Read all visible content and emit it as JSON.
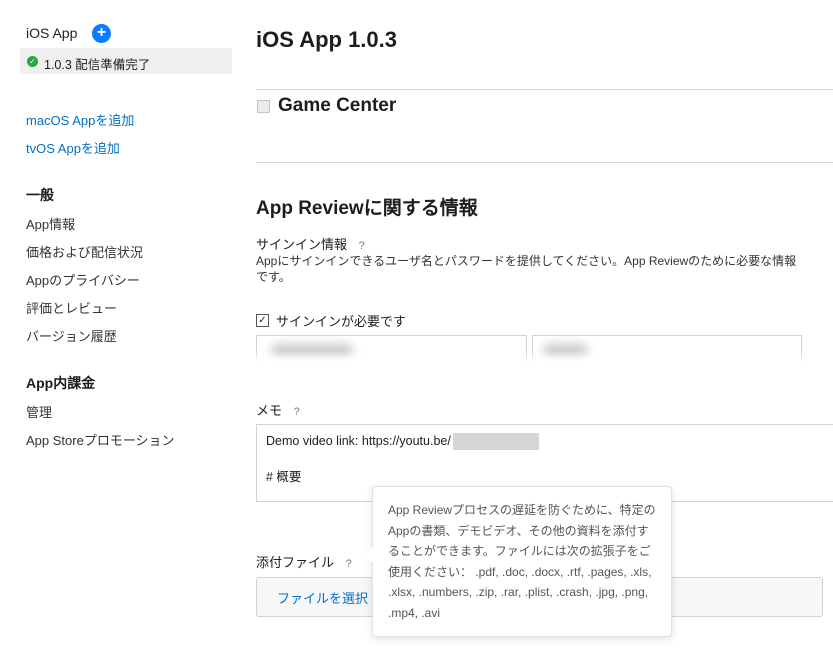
{
  "sidebar": {
    "app_title": "iOS App",
    "add_symbol": "+",
    "status_text": "1.0.3 配信準備完了",
    "status_color": "#28a745",
    "links": [
      "macOS Appを追加",
      "tvOS Appを追加"
    ],
    "general_heading": "一般",
    "general_items": [
      "App情報",
      "価格および配信状況",
      "Appのプライバシー",
      "評価とレビュー",
      "バージョン履歴"
    ],
    "iap_heading": "App内課金",
    "iap_items": [
      "管理",
      "App Storeプロモーション"
    ]
  },
  "main": {
    "title": "iOS App 1.0.3",
    "game_center_label": "Game Center",
    "review_section_title": "App Reviewに関する情報",
    "signin_info_label": "サインイン情報",
    "help_symbol": "?",
    "signin_description": "Appにサインインできるユーザ名とパスワードを提供してください。App Reviewのために必要な情報です。",
    "signin_required_label": "サインインが必要です",
    "signin_required_checked": true,
    "memo_label": "メモ",
    "memo_line1": "Demo video link: https://youtu.be/",
    "memo_line2": "# 概要",
    "attachment_label": "添付ファイル",
    "choose_file_label": "ファイルを選択",
    "tooltip_text": "App Reviewプロセスの遅延を防ぐために、特定のAppの書類、デモビデオ、その他の資料を添付することができます。ファイルには次の拡張子をご使用ください： .pdf, .doc, .docx, .rtf, .pages, .xls, .xlsx, .numbers, .zip, .rar, .plist, .crash, .jpg, .png, .mp4, .avi"
  },
  "colors": {
    "link": "#0070c9",
    "accent_button": "#0a7aff"
  }
}
